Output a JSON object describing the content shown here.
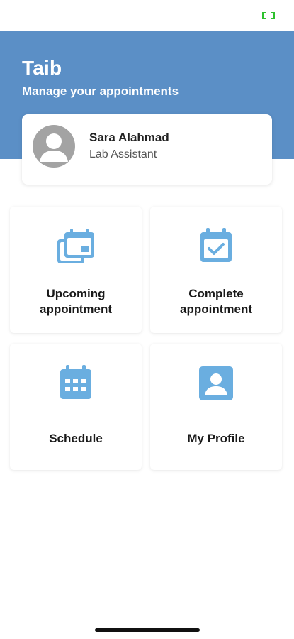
{
  "status_bar": {
    "icon": "screen-mirroring-icon",
    "icon_color": "#2ec12e"
  },
  "header": {
    "title": "Taib",
    "subtitle": "Manage your appointments",
    "background": "#5b8fc6"
  },
  "profile": {
    "name": "Sara Alahmad",
    "role": "Lab Assistant",
    "avatar_icon": "default-user-avatar-icon"
  },
  "tiles": [
    {
      "label": "Upcoming\nappointment",
      "icon": "calendar-stack-icon"
    },
    {
      "label": "Complete\nappointment",
      "icon": "calendar-check-icon"
    },
    {
      "label": "Schedule",
      "icon": "calendar-grid-icon"
    },
    {
      "label": "My Profile",
      "icon": "profile-card-icon"
    }
  ],
  "colors": {
    "icon_accent": "#6aaee0",
    "card_bg": "#ffffff"
  }
}
